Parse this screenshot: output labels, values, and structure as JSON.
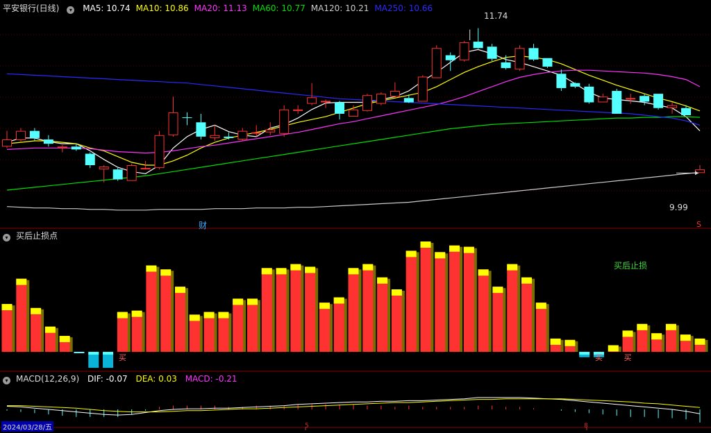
{
  "colors": {
    "up": "#ff3232",
    "down": "#54ffff",
    "ma5": "#ffffff",
    "ma10": "#ffff00",
    "ma20": "#ff33ff",
    "ma60": "#00e000",
    "ma120": "#cccccc",
    "ma250": "#2a2aff",
    "bar_top": "#ffff00",
    "bar_shadow": "#7a6e00",
    "grid": "#8a0000"
  },
  "main": {
    "title": "平安银行(日线)",
    "ma_labels": [
      "MA5: 10.74",
      "MA10: 10.86",
      "MA20: 11.13",
      "MA60: 10.77",
      "MA120: 10.21",
      "MA250: 10.66"
    ],
    "high_label": "11.74",
    "low_label": "9.99",
    "event_mark": "财",
    "right_mark": "S"
  },
  "panel2": {
    "title": "买后止损点",
    "label": "买后止损",
    "buy_marker": "买"
  },
  "panel3": {
    "title": "MACD(12,26,9)",
    "dif": "DIF: -0.07",
    "dea": "DEA: 0.03",
    "macd": "MACD: -0.21",
    "date_label": "2024/03/28/五",
    "month_mark": "5",
    "year_mark": "8"
  },
  "chart_data": [
    {
      "type": "candlestick",
      "title": "平安银行(日线)",
      "ylim": [
        9.4,
        12.2
      ],
      "fields": [
        "open",
        "close",
        "high",
        "low"
      ],
      "candles": [
        [
          10.36,
          10.46,
          10.58,
          10.34
        ],
        [
          10.45,
          10.58,
          10.62,
          10.43
        ],
        [
          10.58,
          10.48,
          10.62,
          10.44
        ],
        [
          10.46,
          10.4,
          10.52,
          10.36
        ],
        [
          10.34,
          10.36,
          10.38,
          10.28
        ],
        [
          10.36,
          10.32,
          10.4,
          10.3
        ],
        [
          10.26,
          10.1,
          10.28,
          10.06
        ],
        [
          10.04,
          10.08,
          10.1,
          9.86
        ],
        [
          10.04,
          9.9,
          10.06,
          9.88
        ],
        [
          9.88,
          10.1,
          10.12,
          9.88
        ],
        [
          10.06,
          10.06,
          10.16,
          10.04
        ],
        [
          10.06,
          10.52,
          10.58,
          10.04
        ],
        [
          10.52,
          10.84,
          11.06,
          10.5
        ],
        [
          10.77,
          10.76,
          10.84,
          10.66
        ],
        [
          10.7,
          10.5,
          10.82,
          10.46
        ],
        [
          10.48,
          10.52,
          10.66,
          10.44
        ],
        [
          10.5,
          10.48,
          10.56,
          10.46
        ],
        [
          10.46,
          10.58,
          10.62,
          10.44
        ],
        [
          10.56,
          10.56,
          10.66,
          10.5
        ],
        [
          10.56,
          10.6,
          10.7,
          10.52
        ],
        [
          10.54,
          10.88,
          10.94,
          10.5
        ],
        [
          10.86,
          10.88,
          10.94,
          10.82
        ],
        [
          10.96,
          11.05,
          11.25,
          10.94
        ],
        [
          11.0,
          11.0,
          11.02,
          10.9
        ],
        [
          10.98,
          10.82,
          11.0,
          10.74
        ],
        [
          10.78,
          10.88,
          10.94,
          10.78
        ],
        [
          10.86,
          11.08,
          11.1,
          10.85
        ],
        [
          10.96,
          11.1,
          11.12,
          10.94
        ],
        [
          11.06,
          11.14,
          11.26,
          11.05
        ],
        [
          11.04,
          10.98,
          11.09,
          10.97
        ],
        [
          10.99,
          11.34,
          11.36,
          10.99
        ],
        [
          11.32,
          11.74,
          11.78,
          11.32
        ],
        [
          11.64,
          11.57,
          11.68,
          11.42
        ],
        [
          11.57,
          11.82,
          11.84,
          11.55
        ],
        [
          11.83,
          11.74,
          12.02,
          11.73
        ],
        [
          11.76,
          11.59,
          11.8,
          11.56
        ],
        [
          11.54,
          11.46,
          11.64,
          11.44
        ],
        [
          11.44,
          11.74,
          11.78,
          11.42
        ],
        [
          11.74,
          11.58,
          11.8,
          11.56
        ],
        [
          11.6,
          11.48,
          11.6,
          11.46
        ],
        [
          11.38,
          11.18,
          11.44,
          11.14
        ],
        [
          11.25,
          11.2,
          11.26,
          11.18
        ],
        [
          11.2,
          10.98,
          11.24,
          10.96
        ],
        [
          10.98,
          11.06,
          11.1,
          10.98
        ],
        [
          11.14,
          10.82,
          11.17,
          10.84
        ],
        [
          11.04,
          11.04,
          11.1,
          10.96
        ],
        [
          11.07,
          10.99,
          11.1,
          10.94
        ],
        [
          11.1,
          10.9,
          11.1,
          10.88
        ],
        [
          10.9,
          10.94,
          10.98,
          10.82
        ],
        [
          10.9,
          10.8,
          10.94,
          10.8
        ],
        [
          9.99,
          10.04,
          10.1,
          9.99
        ]
      ],
      "series": [
        {
          "name": "MA5",
          "values": [
            10.42,
            10.48,
            10.48,
            10.43,
            10.4,
            10.4,
            10.3,
            10.18,
            10.07,
            10.01,
            9.98,
            10.1,
            10.34,
            10.5,
            10.6,
            10.66,
            10.57,
            10.52,
            10.5,
            10.62,
            10.67,
            10.76,
            10.88,
            10.97,
            10.98,
            10.98,
            10.98,
            11.02,
            11.06,
            11.14,
            11.28,
            11.4,
            11.54,
            11.68,
            11.72,
            11.66,
            11.58,
            11.54,
            11.48,
            11.42,
            11.36,
            11.24,
            11.12,
            11.04,
            11.02,
            11.0,
            10.98,
            10.94,
            10.9,
            10.78,
            10.58
          ]
        },
        {
          "name": "MA10",
          "values": [
            10.4,
            10.42,
            10.44,
            10.44,
            10.42,
            10.4,
            10.34,
            10.3,
            10.22,
            10.14,
            10.1,
            10.1,
            10.16,
            10.24,
            10.34,
            10.42,
            10.48,
            10.52,
            10.56,
            10.6,
            10.65,
            10.7,
            10.74,
            10.78,
            10.84,
            10.9,
            10.96,
            11.0,
            11.04,
            11.08,
            11.12,
            11.2,
            11.3,
            11.4,
            11.48,
            11.55,
            11.61,
            11.63,
            11.61,
            11.58,
            11.52,
            11.44,
            11.36,
            11.29,
            11.22,
            11.16,
            11.1,
            11.04,
            10.99,
            10.93,
            10.86
          ]
        },
        {
          "name": "MA20",
          "values": [
            10.32,
            10.33,
            10.34,
            10.34,
            10.34,
            10.34,
            10.33,
            10.31,
            10.29,
            10.28,
            10.27,
            10.28,
            10.3,
            10.33,
            10.36,
            10.38,
            10.41,
            10.44,
            10.47,
            10.5,
            10.53,
            10.56,
            10.6,
            10.64,
            10.68,
            10.71,
            10.75,
            10.79,
            10.83,
            10.87,
            10.91,
            10.95,
            11.0,
            11.06,
            11.13,
            11.2,
            11.27,
            11.33,
            11.37,
            11.4,
            11.42,
            11.43,
            11.43,
            11.42,
            11.41,
            11.4,
            11.39,
            11.37,
            11.34,
            11.3,
            11.2
          ]
        },
        {
          "name": "MA60",
          "values": [
            9.75,
            9.77,
            9.79,
            9.81,
            9.83,
            9.85,
            9.87,
            9.89,
            9.91,
            9.93,
            9.95,
            9.98,
            10.01,
            10.04,
            10.07,
            10.1,
            10.13,
            10.16,
            10.19,
            10.22,
            10.25,
            10.28,
            10.31,
            10.34,
            10.37,
            10.4,
            10.43,
            10.46,
            10.49,
            10.52,
            10.55,
            10.58,
            10.61,
            10.63,
            10.65,
            10.67,
            10.68,
            10.69,
            10.7,
            10.71,
            10.72,
            10.73,
            10.74,
            10.75,
            10.76,
            10.76,
            10.77,
            10.77,
            10.78,
            10.78,
            10.77
          ]
        },
        {
          "name": "MA120",
          "values": [
            9.52,
            9.51,
            9.5,
            9.5,
            9.49,
            9.49,
            9.48,
            9.48,
            9.47,
            9.47,
            9.47,
            9.48,
            9.48,
            9.48,
            9.48,
            9.49,
            9.49,
            9.49,
            9.5,
            9.5,
            9.5,
            9.51,
            9.51,
            9.52,
            9.53,
            9.54,
            9.55,
            9.56,
            9.57,
            9.58,
            9.6,
            9.62,
            9.64,
            9.66,
            9.68,
            9.7,
            9.72,
            9.74,
            9.76,
            9.78,
            9.8,
            9.82,
            9.84,
            9.86,
            9.88,
            9.9,
            9.92,
            9.94,
            9.96,
            9.98,
            10.0
          ]
        },
        {
          "name": "MA250",
          "values": [
            11.38,
            11.37,
            11.36,
            11.35,
            11.34,
            11.33,
            11.32,
            11.31,
            11.3,
            11.29,
            11.28,
            11.27,
            11.26,
            11.25,
            11.23,
            11.21,
            11.19,
            11.17,
            11.15,
            11.13,
            11.11,
            11.09,
            11.07,
            11.05,
            11.03,
            11.02,
            11.01,
            11.0,
            10.99,
            10.98,
            10.97,
            10.96,
            10.95,
            10.94,
            10.93,
            10.92,
            10.91,
            10.9,
            10.89,
            10.88,
            10.87,
            10.86,
            10.85,
            10.84,
            10.83,
            10.82,
            10.8,
            10.78,
            10.76,
            10.72,
            10.66
          ]
        }
      ]
    },
    {
      "type": "bar",
      "title": "买后止损点",
      "ylim": [
        -13,
        83
      ],
      "values": [
        36,
        55,
        33,
        19,
        12,
        -1,
        -12,
        -12,
        30,
        31,
        65,
        62,
        49,
        28,
        30,
        30,
        40,
        40,
        63,
        63,
        66,
        64,
        37,
        41,
        63,
        66,
        56,
        47,
        76,
        83,
        75,
        80,
        79,
        62,
        49,
        66,
        56,
        37,
        10,
        9,
        -4,
        -4,
        5,
        16,
        21,
        14,
        21,
        13,
        10
      ],
      "signal_text": [
        "",
        "",
        "",
        "",
        "",
        "",
        "",
        "",
        "买",
        "",
        "",
        "",
        "",
        "",
        "",
        "",
        "",
        "",
        "",
        "",
        "",
        "",
        "",
        "",
        "",
        "",
        "",
        "",
        "",
        "",
        "",
        "",
        "",
        "",
        "",
        "",
        "",
        "",
        "",
        "",
        "",
        "买",
        "",
        "买",
        "",
        "",
        "",
        "",
        ""
      ]
    },
    {
      "type": "line",
      "title": "MACD(12,26,9)",
      "series": [
        {
          "name": "DIF",
          "values": [
            0.05,
            0.04,
            0.02,
            0.0,
            -0.02,
            -0.04,
            -0.06,
            -0.08,
            -0.09,
            -0.08,
            -0.05,
            -0.02,
            0.0,
            0.01,
            0.01,
            0.02,
            0.02,
            0.03,
            0.04,
            0.05,
            0.06,
            0.08,
            0.09,
            0.1,
            0.11,
            0.12,
            0.12,
            0.13,
            0.13,
            0.14,
            0.14,
            0.15,
            0.16,
            0.17,
            0.19,
            0.19,
            0.19,
            0.19,
            0.18,
            0.17,
            0.16,
            0.14,
            0.12,
            0.1,
            0.08,
            0.06,
            0.04,
            0.02,
            0.0,
            -0.03,
            -0.07
          ]
        },
        {
          "name": "DEA",
          "values": [
            0.06,
            0.06,
            0.05,
            0.04,
            0.03,
            0.02,
            0.0,
            -0.02,
            -0.03,
            -0.04,
            -0.04,
            -0.04,
            -0.03,
            -0.02,
            -0.02,
            -0.01,
            0.0,
            0.01,
            0.01,
            0.02,
            0.03,
            0.04,
            0.05,
            0.06,
            0.07,
            0.08,
            0.09,
            0.1,
            0.11,
            0.11,
            0.12,
            0.13,
            0.14,
            0.15,
            0.16,
            0.16,
            0.17,
            0.17,
            0.17,
            0.17,
            0.17,
            0.16,
            0.15,
            0.14,
            0.13,
            0.12,
            0.1,
            0.09,
            0.07,
            0.05,
            0.03
          ]
        },
        {
          "name": "MACD",
          "values": [
            -0.02,
            -0.04,
            -0.06,
            -0.08,
            -0.1,
            -0.12,
            -0.12,
            -0.12,
            -0.12,
            -0.08,
            -0.02,
            0.04,
            0.06,
            0.06,
            0.06,
            0.06,
            0.04,
            0.04,
            0.06,
            0.06,
            0.06,
            0.08,
            0.08,
            0.08,
            0.08,
            0.08,
            0.06,
            0.06,
            0.04,
            0.06,
            0.04,
            0.04,
            0.04,
            0.04,
            0.06,
            0.06,
            0.04,
            0.04,
            0.02,
            0.0,
            -0.02,
            -0.04,
            -0.06,
            -0.08,
            -0.1,
            -0.12,
            -0.12,
            -0.14,
            -0.14,
            -0.16,
            -0.21
          ]
        }
      ]
    }
  ]
}
